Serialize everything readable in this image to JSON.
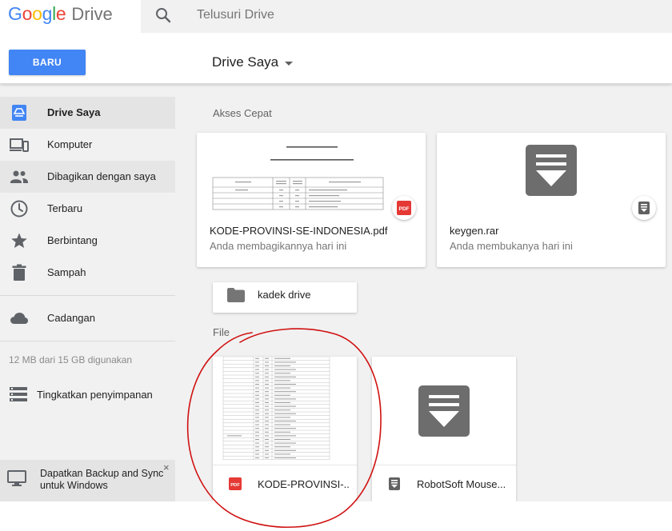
{
  "logo": {
    "letters": [
      "G",
      "o",
      "o",
      "g",
      "l",
      "e"
    ],
    "letter_colors": [
      "#4285f4",
      "#ea4335",
      "#fbbc05",
      "#4285f4",
      "#34a853",
      "#ea4335"
    ],
    "product": "Drive"
  },
  "search": {
    "placeholder": "Telusuri Drive",
    "icon": "search-icon"
  },
  "new_button": {
    "label": "BARU",
    "color": "#4285f4"
  },
  "header": {
    "title": "Drive Saya"
  },
  "sidebar": {
    "items": [
      {
        "label": "Drive Saya",
        "icon": "my-drive-icon",
        "state": "selected"
      },
      {
        "label": "Komputer",
        "icon": "computer-icon"
      },
      {
        "label": "Dibagikan dengan saya",
        "icon": "shared-people-icon",
        "state": "hover"
      },
      {
        "label": "Terbaru",
        "icon": "clock-icon"
      },
      {
        "label": "Berbintang",
        "icon": "star-icon"
      },
      {
        "label": "Sampah",
        "icon": "trash-icon"
      }
    ],
    "backups": {
      "label": "Cadangan",
      "icon": "cloud-icon"
    },
    "storage_text": "12 MB dari 15 GB digunakan",
    "upgrade_label": "Tingkatkan penyimpanan",
    "backup_promo": {
      "text": "Dapatkan Backup and Sync untuk Windows",
      "close": "×"
    }
  },
  "main": {
    "quick_access_label": "Akses Cepat",
    "quick_access": [
      {
        "name": "KODE-PROVINSI-SE-INDONESIA.pdf",
        "subtitle": "Anda membagikannya hari ini",
        "badge": "PDF",
        "badge_color": "#e53935"
      },
      {
        "name": "keygen.rar",
        "subtitle": "Anda membukanya hari ini",
        "badge_icon": "archive-icon"
      }
    ],
    "folder": {
      "name": "kadek drive",
      "icon": "folder-icon"
    },
    "files_label": "File",
    "files": [
      {
        "name": "KODE-PROVINSI-...",
        "icon": "pdf-file-icon",
        "icon_color": "#e53935"
      },
      {
        "name": "RobotSoft Mouse...",
        "icon": "archive-file-icon",
        "icon_color": "#616161"
      }
    ]
  },
  "annotation": {
    "color": "#d01010"
  }
}
